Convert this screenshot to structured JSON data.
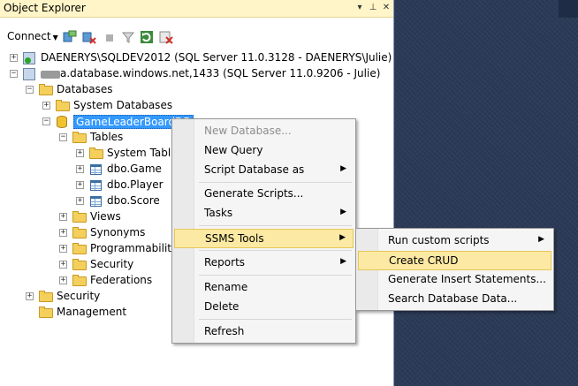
{
  "window": {
    "title": "Object Explorer",
    "pin_glyph": "▾",
    "dock_glyph": "⊥",
    "close_glyph": "✕"
  },
  "toolbar": {
    "connect_label": "Connect",
    "connect_caret": "▼",
    "icons": [
      "connect-object-explorer-icon",
      "disconnect-icon",
      "stop-icon",
      "filter-icon",
      "refresh-icon",
      "disconnect-all-icon"
    ]
  },
  "tree": {
    "server1_label": "DAENERYS\\SQLDEV2012 (SQL Server 11.0.3128 - DAENERYS\\Julie)",
    "server2_label": "a.database.windows.net,1433 (SQL Server 11.0.9206 - Julie)",
    "databases_label": "Databases",
    "system_databases_label": "System Databases",
    "gameleaderboard_label": "GameLeaderBoardDB",
    "tables_label": "Tables",
    "system_tables_label": "System Tables",
    "table_game": "dbo.Game",
    "table_player": "dbo.Player",
    "table_score": "dbo.Score",
    "views_label": "Views",
    "synonyms_label": "Synonyms",
    "programmability_label": "Programmability",
    "security_db_label": "Security",
    "federations_label": "Federations",
    "security_server_label": "Security",
    "management_label": "Management",
    "expand_plus": "+",
    "expand_minus": "−"
  },
  "context_menu": {
    "items": {
      "new_database": "New Database...",
      "new_query": "New Query",
      "script_database_as": "Script Database as",
      "generate_scripts": "Generate Scripts...",
      "tasks": "Tasks",
      "ssms_tools": "SSMS Tools",
      "reports": "Reports",
      "rename": "Rename",
      "delete": "Delete",
      "refresh": "Refresh"
    },
    "submenu_arrow": "▶"
  },
  "submenu": {
    "items": {
      "run_custom_scripts": "Run custom scripts",
      "create_crud": "Create CRUD",
      "generate_insert": "Generate Insert Statements...",
      "search_database_data": "Search Database Data..."
    }
  },
  "colors": {
    "title_bar": "#fff5c8",
    "selection": "#3399ff",
    "menu_hover": "#fce9a3",
    "workspace_bg": "#2b3a57"
  }
}
